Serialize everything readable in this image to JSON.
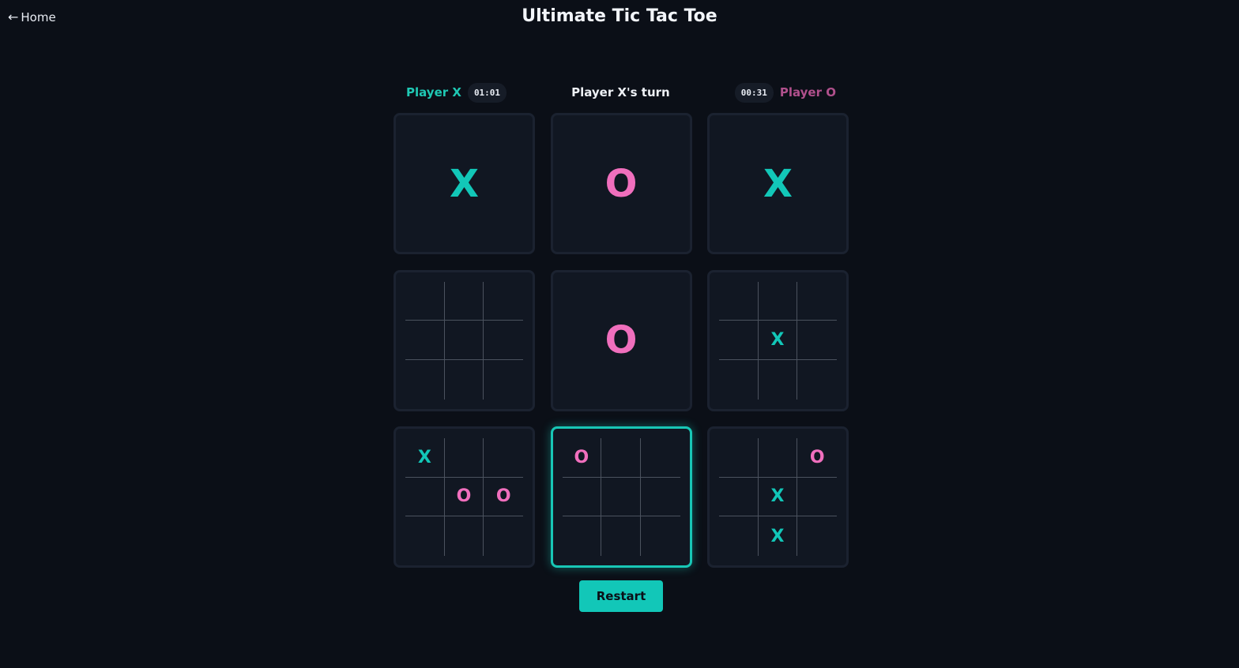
{
  "nav": {
    "back_arrow": "←",
    "home_label": "Home"
  },
  "title": "Ultimate Tic Tac Toe",
  "status": {
    "player_x": {
      "label": "Player X",
      "timer": "01:01",
      "color": "#1fc8b4"
    },
    "player_o": {
      "label": "Player O",
      "timer": "00:31",
      "color": "#b0508c"
    },
    "turn_text": "Player X's turn"
  },
  "board": {
    "active_board": 7,
    "boards": [
      {
        "winner": "X",
        "cells": [
          "",
          "",
          "",
          "",
          "",
          "",
          "",
          "",
          ""
        ]
      },
      {
        "winner": "O",
        "cells": [
          "",
          "",
          "",
          "",
          "",
          "",
          "",
          "",
          ""
        ]
      },
      {
        "winner": "X",
        "cells": [
          "",
          "",
          "",
          "",
          "",
          "",
          "",
          "",
          ""
        ]
      },
      {
        "winner": "",
        "cells": [
          "",
          "",
          "",
          "",
          "",
          "",
          "",
          "",
          ""
        ]
      },
      {
        "winner": "O",
        "cells": [
          "",
          "",
          "",
          "",
          "",
          "",
          "",
          "",
          ""
        ]
      },
      {
        "winner": "",
        "cells": [
          "",
          "",
          "",
          "",
          "X",
          "",
          "",
          "",
          ""
        ]
      },
      {
        "winner": "",
        "cells": [
          "X",
          "",
          "",
          "",
          "O",
          "O",
          "",
          "",
          ""
        ]
      },
      {
        "winner": "",
        "cells": [
          "O",
          "",
          "",
          "",
          "",
          "",
          "",
          "",
          ""
        ]
      },
      {
        "winner": "",
        "cells": [
          "",
          "",
          "O",
          "",
          "X",
          "",
          "",
          "X",
          ""
        ]
      }
    ]
  },
  "controls": {
    "restart_label": "Restart"
  },
  "colors": {
    "x": "#12c7b8",
    "o": "#f06fbd",
    "background": "#0b0f17",
    "active_border": "#18c7b6"
  }
}
